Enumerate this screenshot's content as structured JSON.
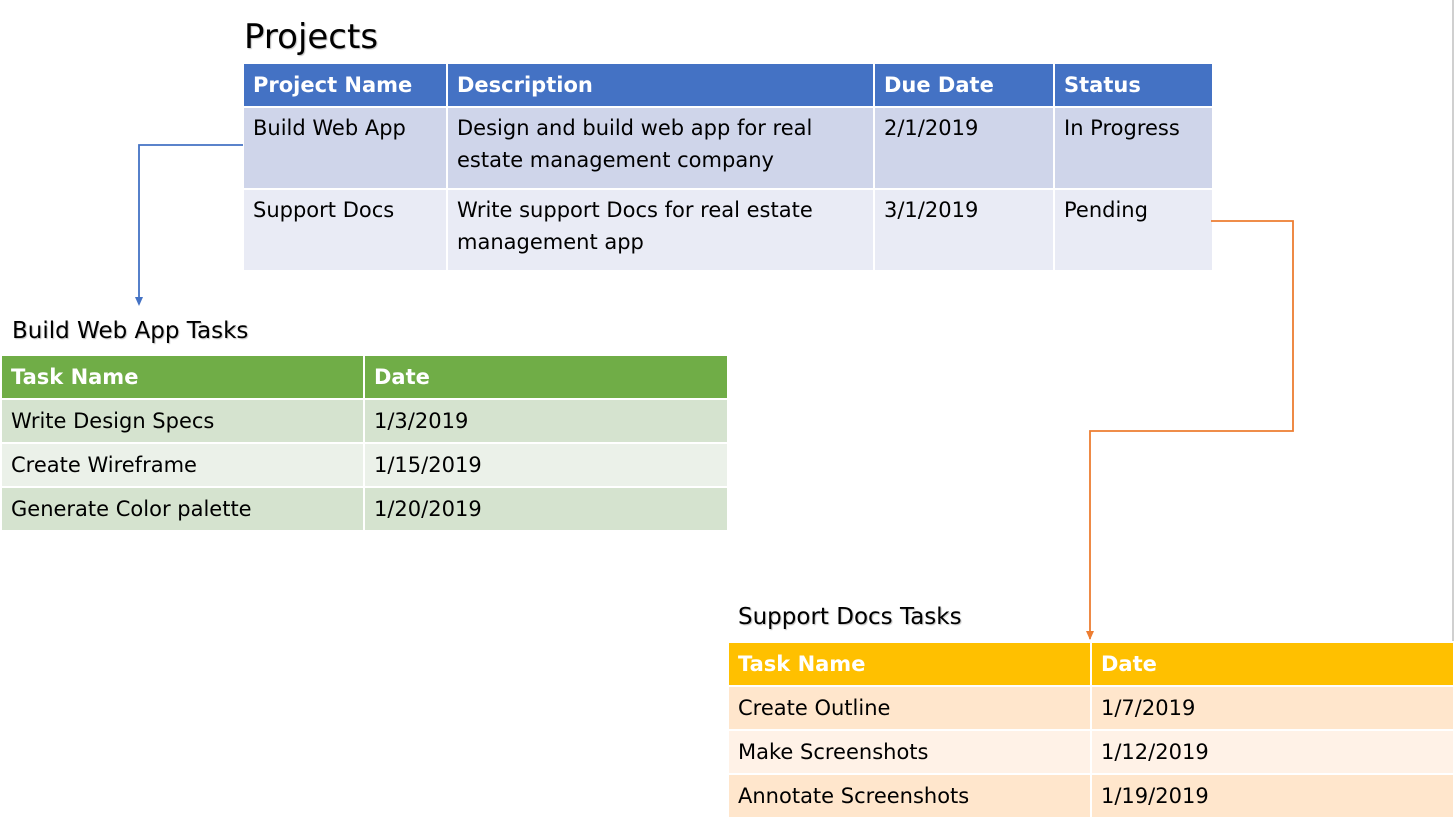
{
  "colors": {
    "projects_header": "#4472c4",
    "build_header": "#70ad47",
    "support_header": "#ffc000",
    "blue_connector": "#4472c4",
    "orange_connector": "#ed7d31"
  },
  "projects": {
    "title": "Projects",
    "headers": [
      "Project Name",
      "Description",
      "Due Date",
      "Status"
    ],
    "rows": [
      [
        "Build Web App",
        "Design and build web app for real estate management company",
        "2/1/2019",
        "In Progress"
      ],
      [
        "Support Docs",
        "Write support Docs for real estate management app",
        "3/1/2019",
        "Pending"
      ]
    ]
  },
  "build_tasks": {
    "title": "Build Web App Tasks",
    "headers": [
      "Task Name",
      "Date"
    ],
    "rows": [
      [
        "Write Design Specs",
        "1/3/2019"
      ],
      [
        "Create Wireframe",
        "1/15/2019"
      ],
      [
        "Generate Color palette",
        "1/20/2019"
      ]
    ]
  },
  "support_tasks": {
    "title": "Support Docs Tasks",
    "headers": [
      "Task Name",
      "Date"
    ],
    "rows": [
      [
        "Create Outline",
        "1/7/2019"
      ],
      [
        "Make Screenshots",
        "1/12/2019"
      ],
      [
        "Annotate Screenshots",
        "1/19/2019"
      ]
    ]
  }
}
